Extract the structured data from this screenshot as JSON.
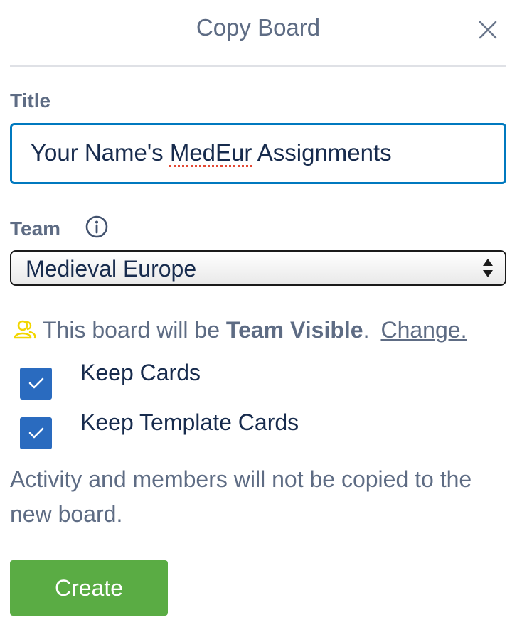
{
  "header": {
    "title": "Copy Board",
    "close_icon": "close-icon"
  },
  "form": {
    "title_label": "Title",
    "title_value_before": "Your Name's ",
    "title_value_misspelled": "MedEur",
    "title_value_after": " Assignments",
    "title_value": "Your Name's MedEur Assignments",
    "team_label": "Team",
    "team_info_icon": "info-circle-icon",
    "team_selected": "Medieval Europe",
    "select_icon": "up-down-arrows-icon"
  },
  "visibility": {
    "icon": "team-people-icon",
    "icon_color": "#f2d600",
    "prefix": "This board will be",
    "level": "Team Visible",
    "suffix": ".",
    "change_link": "Change."
  },
  "options": [
    {
      "label": "Keep Cards",
      "checked": true
    },
    {
      "label": "Keep Template Cards",
      "checked": true
    }
  ],
  "note": "Activity and members will not be copied to the new board.",
  "actions": {
    "create_label": "Create"
  },
  "colors": {
    "accent_blue": "#0079bf",
    "checkbox_blue": "#2a6bbf",
    "create_green": "#5aac44",
    "muted_text": "#5e6c84"
  }
}
